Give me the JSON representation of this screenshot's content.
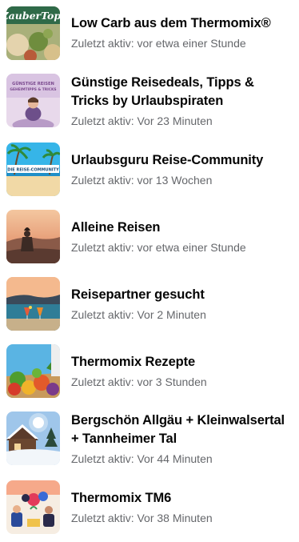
{
  "groups": [
    {
      "name": "Low Carb aus dem Thermomix®",
      "activity": "Zuletzt aktiv: vor etwa einer Stunde",
      "thumb_icon": "zaubertopf-food-thumbnail",
      "thumb_text": "ZauberTopf"
    },
    {
      "name": "Günstige Reisedeals, Tipps & Tricks by Urlaubspiraten",
      "activity": "Zuletzt aktiv: Vor 23 Minuten",
      "thumb_icon": "urlaubspiraten-thumbnail",
      "thumb_text": "GÜNSTIGE REISEN GEHEIMTIPPS & TRICKS"
    },
    {
      "name": "Urlaubsguru Reise-Community",
      "activity": "Zuletzt aktiv: vor 13 Wochen",
      "thumb_icon": "beach-palms-thumbnail",
      "thumb_text": "DIE REISE-COMMUNITY"
    },
    {
      "name": "Alleine Reisen",
      "activity": "Zuletzt aktiv: vor etwa einer Stunde",
      "thumb_icon": "traveler-sunset-thumbnail"
    },
    {
      "name": "Reisepartner gesucht",
      "activity": "Zuletzt aktiv: Vor 2 Minuten",
      "thumb_icon": "lake-drinks-thumbnail"
    },
    {
      "name": "Thermomix Rezepte",
      "activity": "Zuletzt aktiv: vor 3 Stunden",
      "thumb_icon": "vegetables-thumbnail"
    },
    {
      "name": "Bergschön Allgäu + Kleinwalsertal + Tannheimer Tal",
      "activity": "Zuletzt aktiv: Vor 44 Minuten",
      "thumb_icon": "winter-cabin-thumbnail"
    },
    {
      "name": "Thermomix TM6",
      "activity": "Zuletzt aktiv: Vor 38 Minuten",
      "thumb_icon": "illustration-thumbnail"
    }
  ]
}
